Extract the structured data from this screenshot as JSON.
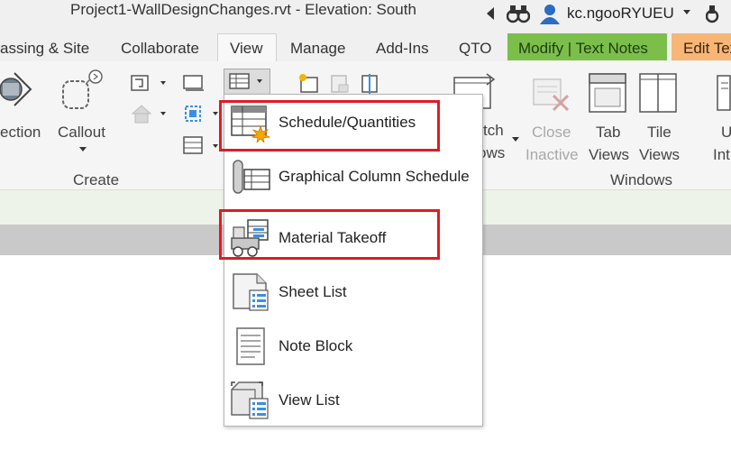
{
  "app": {
    "title": "Project1-WallDesignChanges.rvt - Elevation: South",
    "user": "kc.ngooRYUEU"
  },
  "tabs": [
    {
      "label": "assing & Site"
    },
    {
      "label": "Collaborate"
    },
    {
      "label": "View"
    },
    {
      "label": "Manage"
    },
    {
      "label": "Add-Ins"
    },
    {
      "label": "QTO"
    },
    {
      "label": "Modify | Text Notes"
    },
    {
      "label": "Edit Tex"
    }
  ],
  "ribbon": {
    "section_label": "ection",
    "callout_label": "Callout",
    "create_panel": "Create",
    "switch_line1": "tch",
    "switch_line2": "ows",
    "close_line1": "Close",
    "close_line2": "Inactive",
    "tab_line1": "Tab",
    "tab_line2": "Views",
    "tile_line1": "Tile",
    "tile_line2": "Views",
    "windows_panel": "Windows",
    "ui_line1": "U",
    "ui_line2": "Int"
  },
  "menu": {
    "items": [
      {
        "label": "Schedule/Quantities",
        "icon": "schedule-icon"
      },
      {
        "label": "Graphical Column Schedule",
        "icon": "column-schedule-icon"
      },
      {
        "label": "Material Takeoff",
        "icon": "material-takeoff-icon"
      },
      {
        "label": "Sheet List",
        "icon": "sheet-list-icon"
      },
      {
        "label": "Note Block",
        "icon": "note-block-icon"
      },
      {
        "label": "View List",
        "icon": "view-list-icon"
      }
    ]
  },
  "colors": {
    "highlight": "#e01b24",
    "modify_tab": "#7bbf4a",
    "edit_tab": "#f7b676"
  }
}
